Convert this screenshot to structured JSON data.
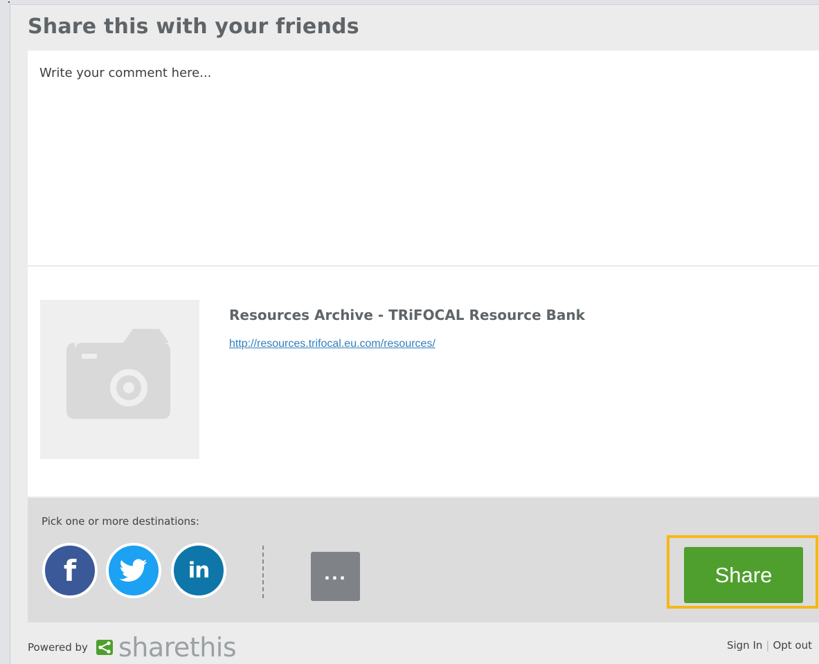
{
  "widget": {
    "title": "Share this with your friends"
  },
  "comment": {
    "placeholder": "Write your comment here..."
  },
  "link_preview": {
    "thumbnail_icon": "camera-icon",
    "title": "Resources Archive - TRiFOCAL Resource Bank",
    "url": "http://resources.trifocal.eu.com/resources/"
  },
  "destinations": {
    "label": "Pick one or more destinations:",
    "services": [
      {
        "name": "facebook",
        "icon": "facebook-icon",
        "glyph": "f",
        "color": "#3b5998"
      },
      {
        "name": "twitter",
        "icon": "twitter-icon",
        "color": "#1da1f2"
      },
      {
        "name": "linkedin",
        "icon": "linkedin-icon",
        "glyph": "in",
        "color": "#0e76a8"
      }
    ],
    "more_glyph": "..."
  },
  "share_button": {
    "label": "Share",
    "color": "#4f9f2e",
    "highlight_color": "#f7b716"
  },
  "footer": {
    "powered_by": "Powered by",
    "brand": "sharethis",
    "brand_icon_color": "#4f9f2e",
    "sign_in": "Sign In",
    "separator": "|",
    "opt_out": "Opt out"
  }
}
